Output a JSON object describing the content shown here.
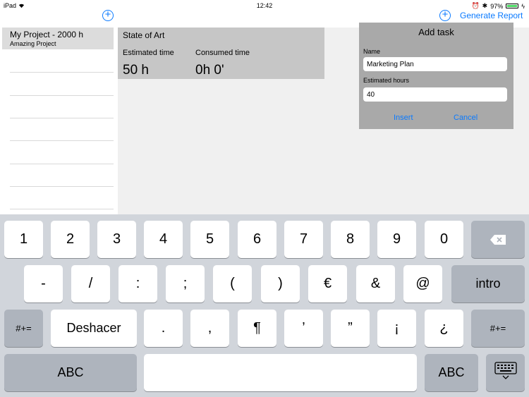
{
  "status_bar": {
    "device": "iPad",
    "time": "12:42",
    "battery": "97%",
    "battery_level": 0.97
  },
  "nav": {
    "add_project_icon": "plus-circle-icon",
    "add_task_icon": "plus-circle-icon",
    "generate_report": "Generate Report"
  },
  "sidebar": {
    "projects": [
      {
        "name": "My Project - 2000 h",
        "subtitle": "Amazing Project"
      }
    ]
  },
  "detail": {
    "state_title": "State of Art",
    "estimated_label": "Estimated time",
    "estimated_value": "50 h",
    "consumed_label": "Consumed time",
    "consumed_value": "0h 0'"
  },
  "add_task": {
    "title": "Add task",
    "name_label": "Name",
    "name_value": "Marketing Plan",
    "hours_label": "Estimated hours",
    "hours_value": "40",
    "insert_label": "Insert",
    "cancel_label": "Cancel"
  },
  "keyboard": {
    "row1": [
      "1",
      "2",
      "3",
      "4",
      "5",
      "6",
      "7",
      "8",
      "9",
      "0"
    ],
    "row2": [
      "-",
      "/",
      ":",
      ";",
      "(",
      ")",
      "€",
      "&",
      "@"
    ],
    "intro": "intro",
    "row3_left": "#+=",
    "undo": "Deshacer",
    "row3": [
      ".",
      ",",
      "¶",
      "’",
      "”",
      "¡",
      "¿"
    ],
    "row3_right": "#+=",
    "abc_left": "ABC",
    "abc_right": "ABC",
    "delete_icon": "backspace-icon",
    "hide_icon": "keyboard-hide-icon"
  },
  "colors": {
    "accent": "#0a7aff",
    "card": "#c6c6c6",
    "panel": "#a9a9a9",
    "keyboard": "#d1d5db"
  }
}
